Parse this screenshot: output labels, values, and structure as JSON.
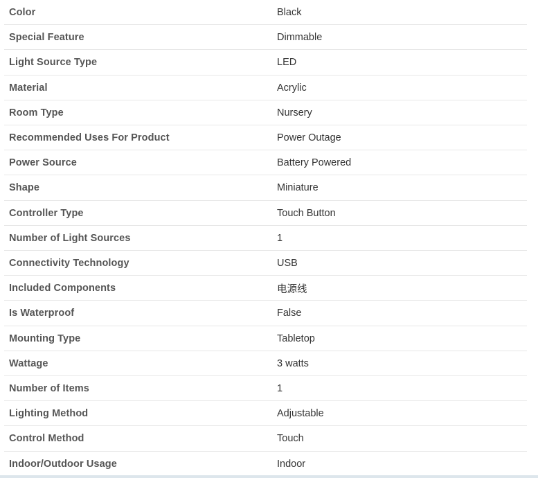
{
  "specs": {
    "rows": [
      {
        "label": "Color",
        "value": "Black"
      },
      {
        "label": "Special Feature",
        "value": "Dimmable"
      },
      {
        "label": "Light Source Type",
        "value": "LED"
      },
      {
        "label": "Material",
        "value": "Acrylic"
      },
      {
        "label": "Room Type",
        "value": "Nursery"
      },
      {
        "label": "Recommended Uses For Product",
        "value": "Power Outage"
      },
      {
        "label": "Power Source",
        "value": "Battery Powered"
      },
      {
        "label": "Shape",
        "value": "Miniature"
      },
      {
        "label": "Controller Type",
        "value": "Touch Button"
      },
      {
        "label": "Number of Light Sources",
        "value": "1"
      },
      {
        "label": "Connectivity Technology",
        "value": "USB"
      },
      {
        "label": "Included Components",
        "value": "电源线"
      },
      {
        "label": "Is Waterproof",
        "value": "False"
      },
      {
        "label": "Mounting Type",
        "value": "Tabletop"
      },
      {
        "label": "Wattage",
        "value": "3 watts"
      },
      {
        "label": "Number of Items",
        "value": "1"
      },
      {
        "label": "Lighting Method",
        "value": "Adjustable"
      },
      {
        "label": "Control Method",
        "value": "Touch"
      },
      {
        "label": "Indoor/Outdoor Usage",
        "value": "Indoor"
      }
    ]
  }
}
